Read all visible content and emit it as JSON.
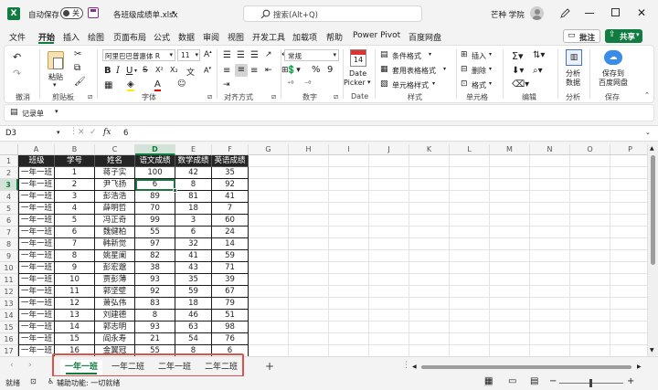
{
  "titlebar": {
    "autosave_label": "自动保存",
    "autosave_state": "关",
    "filename": "各班级成绩单.xlsx",
    "search_placeholder": "搜索(Alt+Q)",
    "user": "芒种 学院"
  },
  "menu": [
    "文件",
    "开始",
    "插入",
    "绘图",
    "页面布局",
    "公式",
    "数据",
    "审阅",
    "视图",
    "开发工具",
    "加载项",
    "帮助",
    "Power Pivot",
    "百度网盘"
  ],
  "menu_active": "开始",
  "actions": {
    "comment": "批注",
    "share": "共享"
  },
  "ribbon": {
    "undo_group": "撤消",
    "paste": "粘贴",
    "clipboard_group": "剪贴板",
    "font_name": "阿里巴巴普惠体 R",
    "font_size": "11",
    "font_group": "字体",
    "align_group": "对齐方式",
    "number_format": "常规",
    "number_group": "数字",
    "date_picker_1": "Date",
    "date_picker_2": "Picker",
    "date_picker_day": "14",
    "date_group": "Date",
    "cond_format": "条件格式",
    "table_format": "套用表格格式",
    "cell_style": "单元格样式",
    "style_group": "样式",
    "insert": "插入",
    "delete": "删除",
    "format": "格式",
    "cells_group": "单元格",
    "edit_group": "编辑",
    "analyze_1": "分析",
    "analyze_2": "数据",
    "analysis_group": "分析",
    "save_baidu_1": "保存到",
    "save_baidu_2": "百度网盘",
    "save_group": "保存"
  },
  "quickbar": {
    "recorder": "记录单"
  },
  "formula_bar": {
    "name_box": "D3",
    "fx": "fx",
    "value": "6"
  },
  "columns": [
    "A",
    "B",
    "C",
    "D",
    "E",
    "F",
    "G",
    "H",
    "I",
    "J",
    "K",
    "L",
    "M",
    "N",
    "O",
    "P"
  ],
  "rows": [
    "1",
    "2",
    "3",
    "4",
    "5",
    "6",
    "7",
    "8",
    "9",
    "10",
    "11",
    "12",
    "13",
    "14",
    "15",
    "16",
    "17"
  ],
  "table": {
    "headers": [
      "班级",
      "学号",
      "姓名",
      "语文成绩",
      "数学成绩",
      "英语成绩"
    ],
    "rows": [
      [
        "一年一班",
        "1",
        "蒋子实",
        "100",
        "42",
        "35"
      ],
      [
        "一年一班",
        "2",
        "尹飞扬",
        "6",
        "8",
        "92"
      ],
      [
        "一年一班",
        "3",
        "彭浩浩",
        "89",
        "81",
        "41"
      ],
      [
        "一年一班",
        "4",
        "薛明哲",
        "70",
        "18",
        "7"
      ],
      [
        "一年一班",
        "5",
        "冯正奇",
        "99",
        "3",
        "60"
      ],
      [
        "一年一班",
        "6",
        "魏健柏",
        "55",
        "6",
        "24"
      ],
      [
        "一年一班",
        "7",
        "韩新觉",
        "97",
        "32",
        "14"
      ],
      [
        "一年一班",
        "8",
        "姚星阑",
        "82",
        "41",
        "59"
      ],
      [
        "一年一班",
        "9",
        "彭宏邈",
        "38",
        "43",
        "71"
      ],
      [
        "一年一班",
        "10",
        "贾彭薄",
        "93",
        "35",
        "39"
      ],
      [
        "一年一班",
        "11",
        "郭坚壁",
        "92",
        "59",
        "67"
      ],
      [
        "一年一班",
        "12",
        "萧弘伟",
        "83",
        "18",
        "79"
      ],
      [
        "一年一班",
        "13",
        "刘建德",
        "8",
        "46",
        "51"
      ],
      [
        "一年一班",
        "14",
        "郭志明",
        "93",
        "63",
        "98"
      ],
      [
        "一年一班",
        "15",
        "阎永寿",
        "21",
        "54",
        "76"
      ],
      [
        "一年一班",
        "16",
        "金翼冠",
        "55",
        "8",
        "6"
      ]
    ]
  },
  "sheets": [
    "一年一班",
    "一年二班",
    "二年一班",
    "二年二班"
  ],
  "active_sheet": "一年一班",
  "add_sheet": "+",
  "status": {
    "ready": "就绪",
    "accessibility": "辅助功能: 一切就绪"
  },
  "colors": {
    "excel_green": "#107c41",
    "header_fill": "#252525",
    "selection": "#217346",
    "highlight_box": "#d9534f"
  }
}
